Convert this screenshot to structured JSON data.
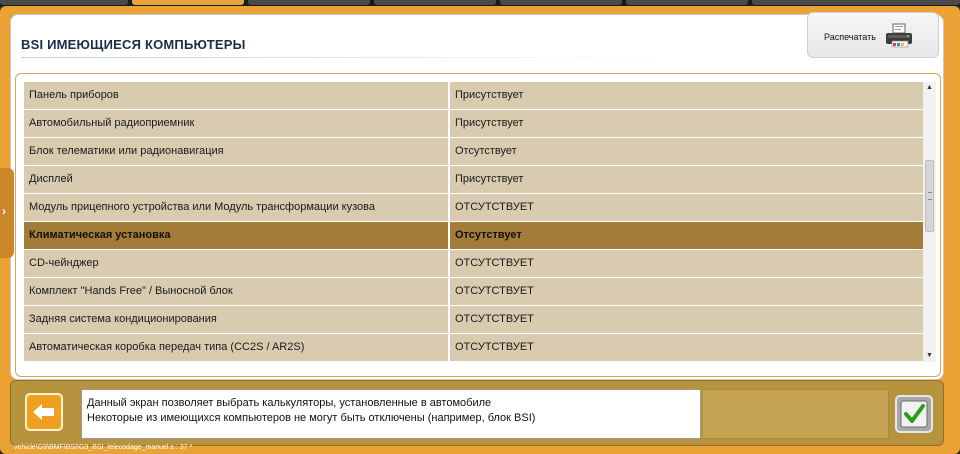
{
  "header": {
    "title": "BSI  ИМЕЮЩИЕСЯ КОМПЬЮТЕРЫ",
    "print_label": "Распечатать"
  },
  "computers": {
    "rows": [
      {
        "name": "Панель приборов",
        "status": "Присутствует"
      },
      {
        "name": "Автомобильный радиоприемник",
        "status": "Присутствует"
      },
      {
        "name": "Блок телематики или радионавигация",
        "status": "Отсутствует"
      },
      {
        "name": "Дисплей",
        "status": "Присутствует"
      },
      {
        "name": "Модуль прицепного устройства или Модуль трансформации кузова",
        "status": "ОТСУТСТВУЕТ"
      },
      {
        "name": "Климатическая установка",
        "status": "Отсутствует",
        "selected": true
      },
      {
        "name": "CD-чейнджер",
        "status": "ОТСУТСТВУЕТ"
      },
      {
        "name": "Комплект \"Hands Free\" / Выносной блок",
        "status": "ОТСУТСТВУЕТ"
      },
      {
        "name": "Задняя система кондиционирования",
        "status": "ОТСУТСТВУЕТ"
      },
      {
        "name": "Автоматическая коробка передач типа (CC2S / AR2S)",
        "status": "ОТСУТСТВУЕТ"
      }
    ]
  },
  "info": {
    "line1": "Данный экран позволяет выбрать калькуляторы, установленные в автомобиле",
    "line2": "Некоторые из имеющихся компьютеров не могут быть отключены (например, блок BSI)"
  },
  "status": {
    "path": "vehicle\\G9\\BMF\\BSI\\G9_BSI_telecodage_manuel.s : 37 *"
  },
  "icons": {
    "print": "printer-icon",
    "back": "arrow-left-icon",
    "ok": "checkmark-icon",
    "side": "chevron-right-icon"
  },
  "colors": {
    "frame": "#e9a233",
    "row": "#d8cbb0",
    "row_selected": "#a47c3a",
    "title": "#1a2e4a",
    "ok_check": "#2e9a1f"
  }
}
